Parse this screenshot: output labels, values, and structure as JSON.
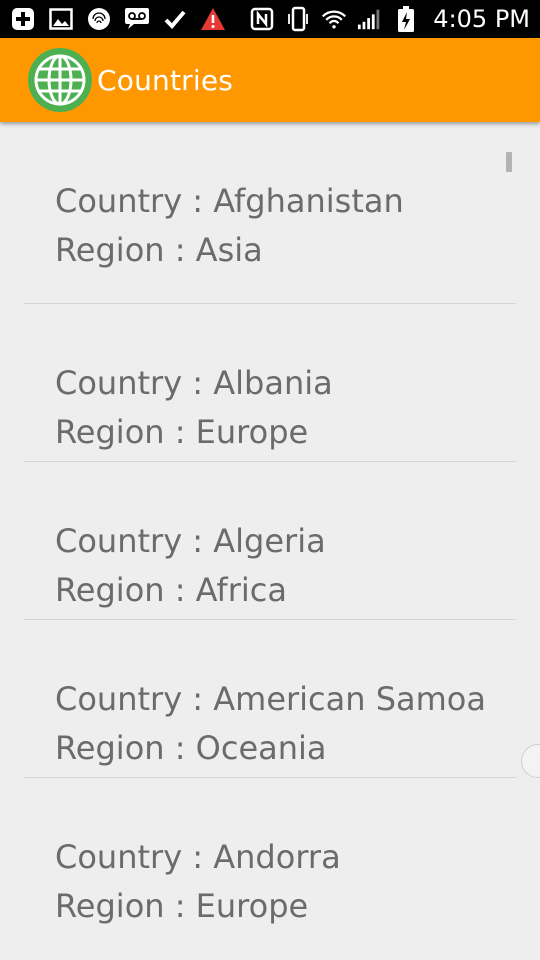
{
  "status_bar": {
    "time": "4:05 PM",
    "left_icons": [
      "plus-square-icon",
      "image-icon",
      "fingerprint-icon",
      "voicemail-icon",
      "check-icon",
      "warning-icon"
    ],
    "right_icons": [
      "nfc-icon",
      "vibrate-icon",
      "wifi-icon",
      "signal-icon",
      "battery-charging-icon"
    ]
  },
  "app_bar": {
    "title": "Countries",
    "logo_icon": "globe-icon",
    "accent_color": "#ff9800"
  },
  "items": [
    {
      "country_line": "Country : Afghanistan",
      "region_line": "Region : Asia"
    },
    {
      "country_line": "Country : Albania",
      "region_line": "Region : Europe"
    },
    {
      "country_line": "Country : Algeria",
      "region_line": "Region : Africa"
    },
    {
      "country_line": "Country : American Samoa",
      "region_line": "Region : Oceania"
    },
    {
      "country_line": "Country : Andorra",
      "region_line": "Region : Europe"
    }
  ]
}
